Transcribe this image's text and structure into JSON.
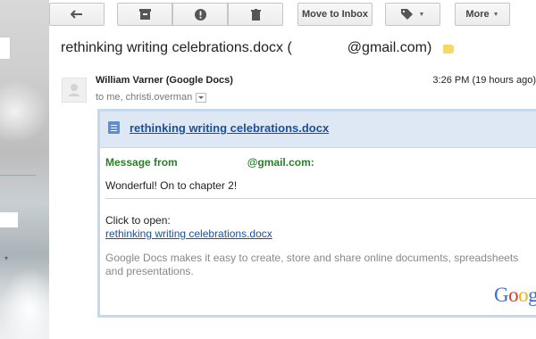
{
  "toolbar": {
    "back_icon": "back-arrow-icon",
    "archive_icon": "archive-icon",
    "spam_icon": "report-spam-icon",
    "delete_icon": "trash-icon",
    "move_to_inbox_label": "Move to Inbox",
    "labels_icon": "label-tag-icon",
    "more_label": "More"
  },
  "email": {
    "subject_prefix": "rethinking writing celebrations.docx (",
    "subject_suffix": "@gmail.com)",
    "sender": "William Varner (Google Docs)",
    "time": "3:26 PM (19 hours ago)",
    "recipients": "to me, christi.overman",
    "label_color": "#f8d765"
  },
  "card": {
    "doc_title": "rethinking writing celebrations.docx",
    "message_from_prefix": "Message from",
    "message_from_suffix": "@gmail.com:",
    "message": "Wonderful! On to chapter 2!",
    "click_to_open": "Click to open:",
    "link_text": "rethinking writing celebrations.docx",
    "description": "Google Docs makes it easy to create, store and share online documents, spreadsheets and presentations.",
    "logo_text": "Goog"
  },
  "colors": {
    "link": "#1a4f9c",
    "message_from": "#2d7d2d",
    "card_header_bg": "#dde8f4"
  }
}
